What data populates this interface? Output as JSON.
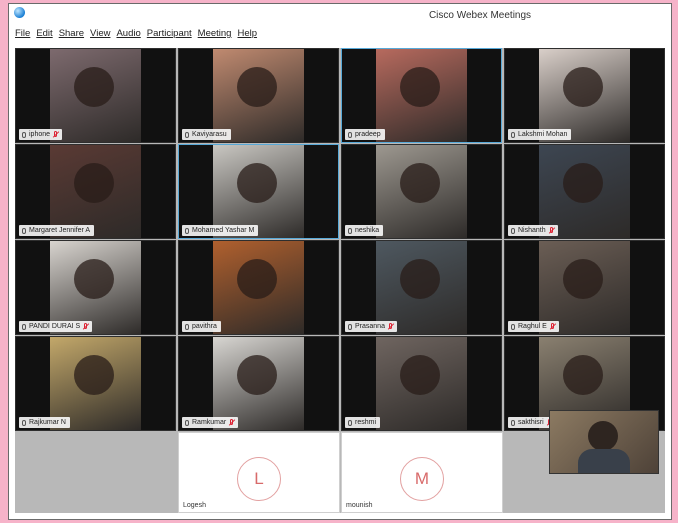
{
  "window": {
    "title": "Cisco Webex Meetings",
    "menus": [
      "File",
      "Edit",
      "Share",
      "View",
      "Audio",
      "Participant",
      "Meeting",
      "Help"
    ]
  },
  "participants": [
    {
      "name": "iphone",
      "muted": true,
      "bg": "#7d6a6e"
    },
    {
      "name": "Kaviyarasu",
      "muted": false,
      "bg": "#c08a70"
    },
    {
      "name": "pradeep",
      "muted": false,
      "bg": "#b76a5e"
    },
    {
      "name": "Lakshmi Mohan",
      "muted": false,
      "bg": "#d9cfc9"
    },
    {
      "name": "Margaret Jennifer A",
      "muted": false,
      "bg": "#5a3a34"
    },
    {
      "name": "Mohamed Yashar M",
      "muted": false,
      "bg": "#c9c7c2"
    },
    {
      "name": "neshika",
      "muted": false,
      "bg": "#9d9890"
    },
    {
      "name": "Nishanth",
      "muted": true,
      "bg": "#3d4652"
    },
    {
      "name": "PANDI DURAI S",
      "muted": true,
      "bg": "#d8d4cf"
    },
    {
      "name": "pavithra",
      "muted": false,
      "bg": "#b0602e"
    },
    {
      "name": "Prasanna",
      "muted": true,
      "bg": "#4e5860"
    },
    {
      "name": "Raghul E",
      "muted": true,
      "bg": "#6b5e55"
    },
    {
      "name": "Rajkumar N",
      "muted": false,
      "bg": "#c3a86a"
    },
    {
      "name": "Ramkumar",
      "muted": true,
      "bg": "#d8d6d2"
    },
    {
      "name": "reshmi",
      "muted": false,
      "bg": "#6f6560"
    },
    {
      "name": "sakthisri",
      "muted": true,
      "bg": "#8a8070"
    }
  ],
  "avatar_participants": [
    {
      "initial": "L",
      "name": "Logesh"
    },
    {
      "initial": "M",
      "name": "mounish"
    }
  ],
  "icons": {
    "app": "webex-logo-icon",
    "mic": "microphone-icon",
    "muted": "muted-mic-icon"
  }
}
